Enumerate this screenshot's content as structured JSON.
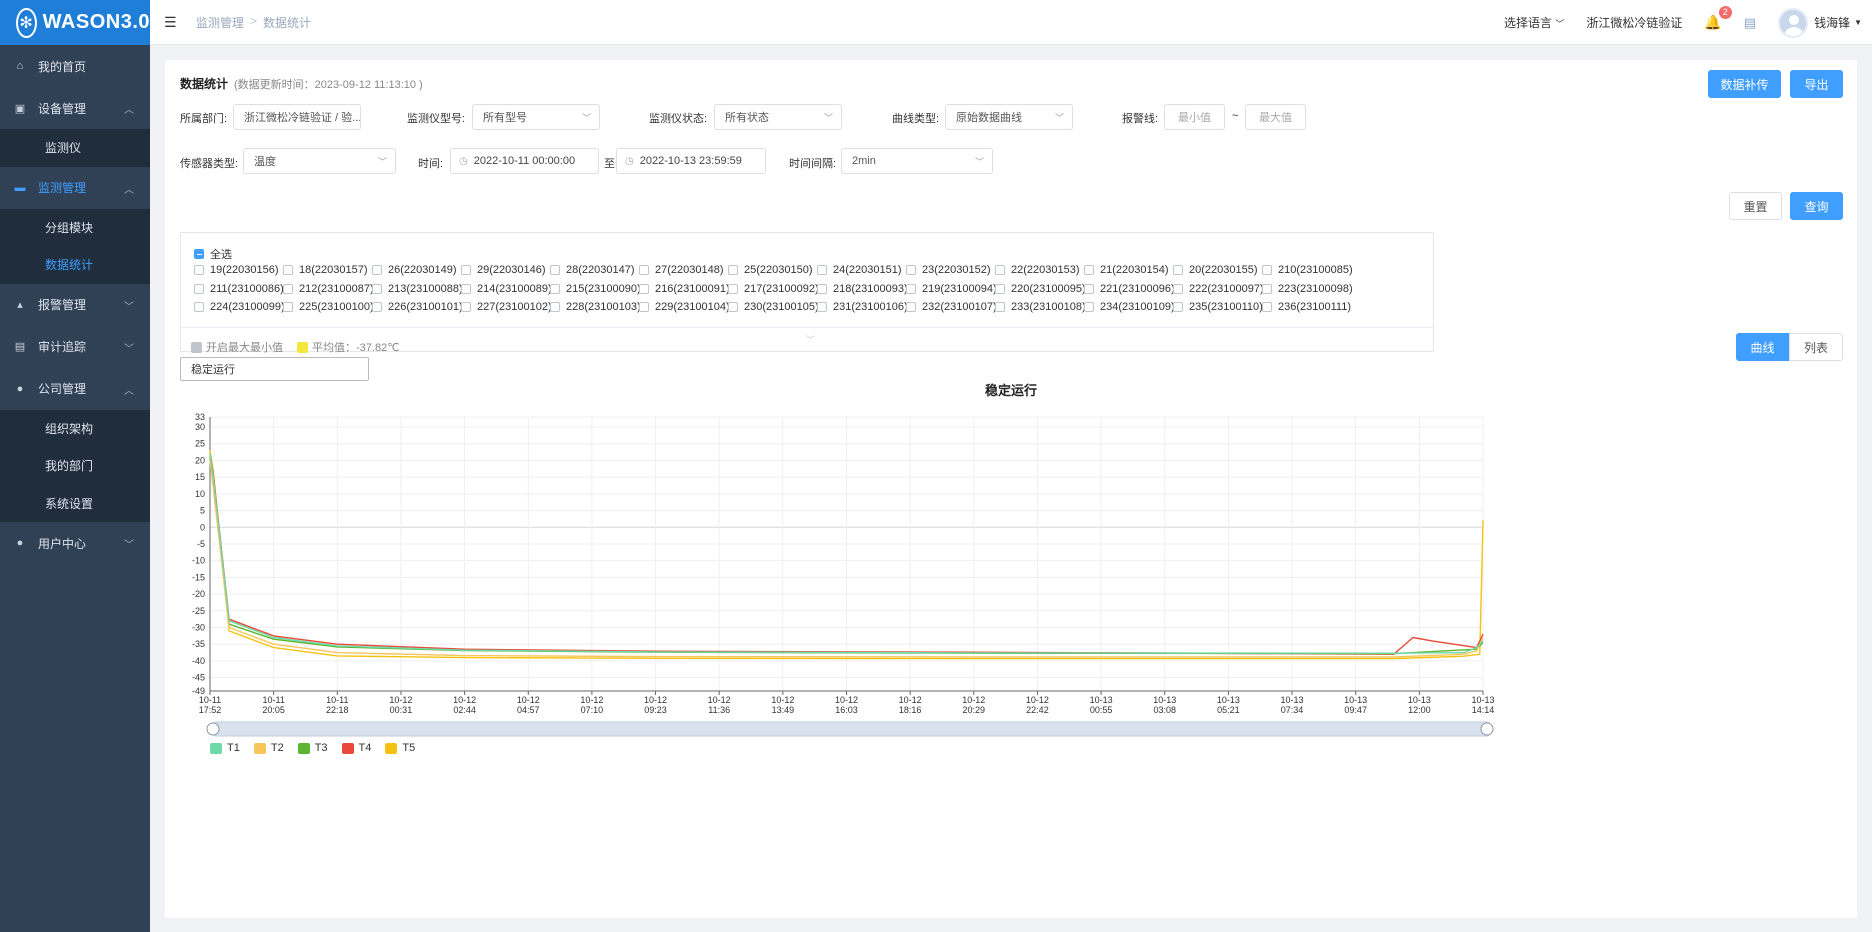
{
  "app": {
    "logo": "WASON3.0"
  },
  "sidebar": {
    "items": [
      {
        "label": "我的首页",
        "icon": "home-icon"
      },
      {
        "label": "设备管理",
        "icon": "monitor-icon",
        "children": [
          "监测仪"
        ]
      },
      {
        "label": "监测管理",
        "icon": "chart-icon",
        "children": [
          "分组模块",
          "数据统计"
        ]
      },
      {
        "label": "报警管理",
        "icon": "alarm-icon"
      },
      {
        "label": "审计追踪",
        "icon": "audit-icon"
      },
      {
        "label": "公司管理",
        "icon": "user-icon",
        "children": [
          "组织架构",
          "我的部门",
          "系统设置"
        ]
      },
      {
        "label": "用户中心",
        "icon": "user-icon"
      }
    ]
  },
  "topbar": {
    "breadcrumb": [
      "监测管理",
      "数据统计"
    ],
    "language": "选择语言",
    "company": "浙江微松冷链验证",
    "notifications": "2",
    "user": "钱海锋"
  },
  "header": {
    "title": "数据统计",
    "updated": "(数据更新时间：2023-09-12 11:13:10 )",
    "supplement_btn": "数据补传",
    "export_btn": "导出"
  },
  "filters": {
    "dept_label": "所属部门:",
    "dept_value": "浙江微松冷链验证 / 验...",
    "model_label": "监测仪型号:",
    "model_value": "所有型号",
    "status_label": "监测仪状态:",
    "status_value": "所有状态",
    "curve_label": "曲线类型:",
    "curve_value": "原始数据曲线",
    "alarm_label": "报警线:",
    "alarm_min": "最小值",
    "alarm_sep": "~",
    "alarm_max": "最大值",
    "sensor_label": "传感器类型:",
    "sensor_value": "温度",
    "time_label": "时间:",
    "time_start": "2022-10-11 00:00:00",
    "time_to": "至",
    "time_end": "2022-10-13 23:59:59",
    "interval_label": "时间间隔:",
    "interval_value": "2min",
    "reset_btn": "重置",
    "query_btn": "查询"
  },
  "devices": {
    "select_all": "全选",
    "list": [
      "19(22030156)",
      "18(22030157)",
      "26(22030149)",
      "29(22030146)",
      "28(22030147)",
      "27(22030148)",
      "25(22030150)",
      "24(22030151)",
      "23(22030152)",
      "22(22030153)",
      "21(22030154)",
      "20(22030155)",
      "210(23100085)",
      "211(23100086)",
      "212(23100087)",
      "213(23100088)",
      "214(23100089)",
      "215(23100090)",
      "216(23100091)",
      "217(23100092)",
      "218(23100093)",
      "219(23100094)",
      "220(23100095)",
      "221(23100096)",
      "222(23100097)",
      "223(23100098)",
      "224(23100099)",
      "225(23100100)",
      "226(23100101)",
      "227(23100102)",
      "228(23100103)",
      "229(23100104)",
      "230(23100105)",
      "231(23100106)",
      "232(23100107)",
      "233(23100108)",
      "234(23100109)",
      "235(23100110)",
      "236(23100111)"
    ]
  },
  "chart_controls": {
    "toggle_minmax": "开启最大最小值",
    "avg": "平均值：-37.82℃",
    "view_curve": "曲线",
    "view_list": "列表",
    "group_select": "稳定运行"
  },
  "colors": {
    "primary": "#409eff",
    "sidebar": "#304156",
    "submenu": "#1f2d3d",
    "logo_bg": "#1f7fd8"
  },
  "chart_data": {
    "type": "line",
    "title": "稳定运行",
    "ylim": [
      -49,
      33
    ],
    "yticks": [
      33,
      30,
      25,
      20,
      15,
      10,
      5,
      0,
      -5,
      -10,
      -15,
      -20,
      -25,
      -30,
      -35,
      -40,
      -45,
      -49
    ],
    "x_ticks": [
      [
        "10-11",
        "17:52"
      ],
      [
        "10-11",
        "20:05"
      ],
      [
        "10-11",
        "22:18"
      ],
      [
        "10-12",
        "00:31"
      ],
      [
        "10-12",
        "02:44"
      ],
      [
        "10-12",
        "04:57"
      ],
      [
        "10-12",
        "07:10"
      ],
      [
        "10-12",
        "09:23"
      ],
      [
        "10-12",
        "11:36"
      ],
      [
        "10-12",
        "13:49"
      ],
      [
        "10-12",
        "16:03"
      ],
      [
        "10-12",
        "18:16"
      ],
      [
        "10-12",
        "20:29"
      ],
      [
        "10-12",
        "22:42"
      ],
      [
        "10-13",
        "00:55"
      ],
      [
        "10-13",
        "03:08"
      ],
      [
        "10-13",
        "05:21"
      ],
      [
        "10-13",
        "07:34"
      ],
      [
        "10-13",
        "09:47"
      ],
      [
        "10-13",
        "12:00"
      ],
      [
        "10-13",
        "14:14"
      ]
    ],
    "grid": true,
    "legend_position": "bottom-left",
    "series": [
      {
        "name": "T1",
        "color": "#6fd9a8",
        "values": [
          [
            0,
            22
          ],
          [
            0.05,
            15
          ],
          [
            0.3,
            -28
          ],
          [
            1,
            -33
          ],
          [
            2,
            -35.5
          ],
          [
            4,
            -36.8
          ],
          [
            7,
            -37.3
          ],
          [
            12,
            -37.6
          ],
          [
            18.6,
            -37.7
          ],
          [
            19.7,
            -37.5
          ],
          [
            19.9,
            -36
          ],
          [
            20,
            -34
          ]
        ]
      },
      {
        "name": "T2",
        "color": "#f7c65b",
        "values": [
          [
            0,
            20
          ],
          [
            0.05,
            12
          ],
          [
            0.3,
            -30
          ],
          [
            1,
            -35
          ],
          [
            2,
            -37.5
          ],
          [
            4,
            -38.4
          ],
          [
            7,
            -38.7
          ],
          [
            12,
            -38.8
          ],
          [
            18.6,
            -38.8
          ],
          [
            19.7,
            -38
          ],
          [
            19.9,
            -37
          ],
          [
            20,
            -33
          ]
        ]
      },
      {
        "name": "T3",
        "color": "#5bb530",
        "values": [
          [
            0,
            21
          ],
          [
            0.05,
            14
          ],
          [
            0.3,
            -29
          ],
          [
            1,
            -33.5
          ],
          [
            2,
            -35.8
          ],
          [
            4,
            -36.9
          ],
          [
            7,
            -37.4
          ],
          [
            12,
            -37.7
          ],
          [
            18.6,
            -37.8
          ],
          [
            19.6,
            -36.8
          ],
          [
            19.9,
            -36.5
          ],
          [
            20,
            -34.5
          ]
        ]
      },
      {
        "name": "T4",
        "color": "#e8493b",
        "values": [
          [
            0,
            22
          ],
          [
            0.05,
            16
          ],
          [
            0.3,
            -27.5
          ],
          [
            1,
            -32.5
          ],
          [
            2,
            -35
          ],
          [
            4,
            -36.5
          ],
          [
            7,
            -37.1
          ],
          [
            12,
            -37.4
          ],
          [
            18.6,
            -38
          ],
          [
            18.9,
            -33
          ],
          [
            19.2,
            -34
          ],
          [
            19.9,
            -36
          ],
          [
            20,
            -32
          ]
        ]
      },
      {
        "name": "T5",
        "color": "#f5c211",
        "values": [
          [
            0,
            23
          ],
          [
            0.05,
            17
          ],
          [
            0.3,
            -31
          ],
          [
            1,
            -36
          ],
          [
            2,
            -38.5
          ],
          [
            4,
            -39
          ],
          [
            7,
            -39.2
          ],
          [
            12,
            -39.3
          ],
          [
            18.6,
            -39.3
          ],
          [
            19.7,
            -38.6
          ],
          [
            19.95,
            -38
          ],
          [
            20,
            2
          ]
        ]
      }
    ]
  }
}
